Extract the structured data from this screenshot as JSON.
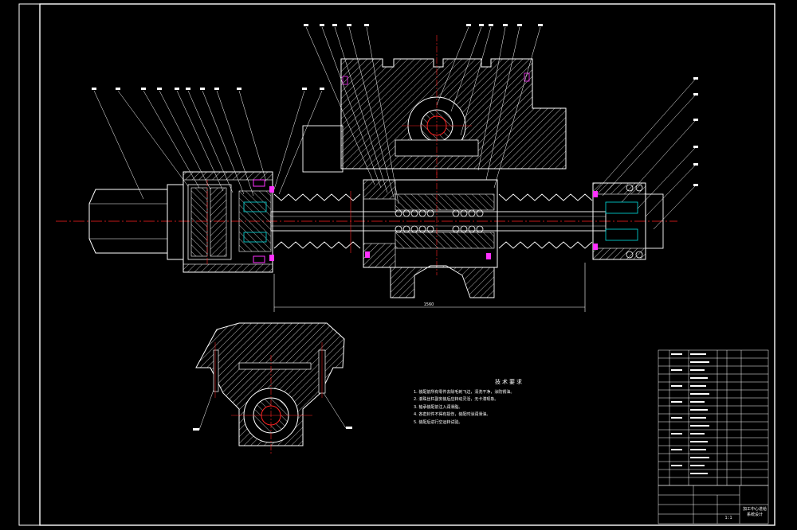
{
  "drawing": {
    "dimension_length": "1560",
    "title_block": {
      "drawing_name": "加工中心进给系统设计",
      "sheet": "1:1"
    },
    "technical_requirements": {
      "title": "技术要求",
      "items": [
        "1. 装配前所有零件去除毛刺飞边，清洗干净，涂防锈油。",
        "2. 滚珠丝杠副安装后应转动灵活，无卡滞现象。",
        "3. 轴承装配前注入润滑脂。",
        "4. 各密封件不得有损伤，装配时涂润滑油。",
        "5. 装配后进行空运转试验。"
      ]
    }
  },
  "colors": {
    "line": "#ffffff",
    "center": "#ff2020",
    "bolt": "#ff30ff",
    "bearing": "#00e0e0"
  }
}
